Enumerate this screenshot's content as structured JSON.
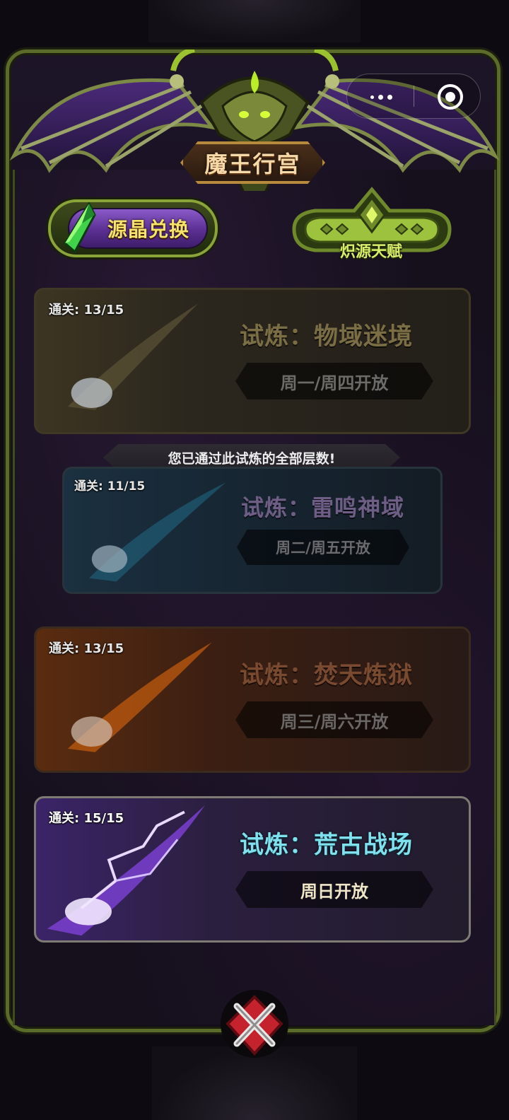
{
  "header": {
    "title": "魔王行宫"
  },
  "toolbar": {
    "exchange_label": "源晶兑换",
    "talent_label": "炽源天赋"
  },
  "trials": [
    {
      "progress": "通关: 13/15",
      "name": "试炼：物域迷境",
      "schedule": "周一/周四开放",
      "state": "locked"
    },
    {
      "progress": "通关: 11/15",
      "name": "试炼：雷鸣神域",
      "schedule": "周二/周五开放",
      "state": "locked"
    },
    {
      "progress": "通关: 13/15",
      "name": "试炼：焚天炼狱",
      "schedule": "周三/周六开放",
      "state": "locked"
    },
    {
      "progress": "通关: 15/15",
      "name": "试炼：荒古战场",
      "schedule": "周日开放",
      "state": "open"
    }
  ],
  "notice": "您已通过此试炼的全部层数!",
  "icons": {
    "capsule_more": "more-dots-icon",
    "capsule_close": "target-close-icon",
    "gem": "green-crystal-icon",
    "bottom": "crossed-close-icon"
  },
  "colors": {
    "frame_green": "#8aa43a",
    "title_text": "#f6d9a8",
    "exchange_text": "#f7e36a",
    "talent_text": "#d8ef6a",
    "open_trial_name": "#7fe0ee"
  }
}
